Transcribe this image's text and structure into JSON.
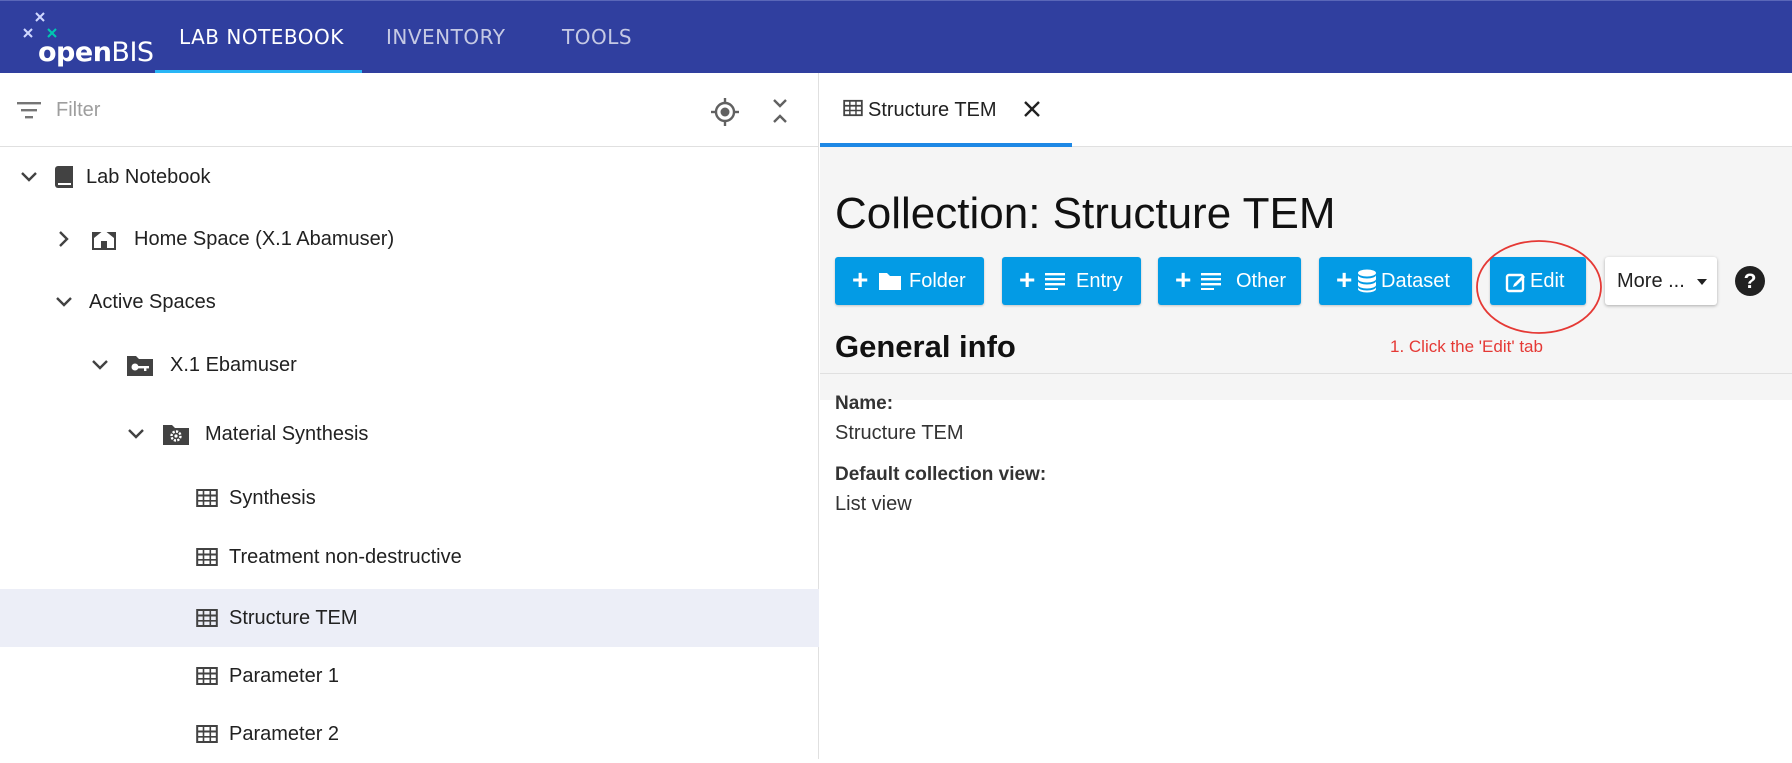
{
  "app": {
    "logo_text_bold": "open",
    "logo_text_rest": "BIS"
  },
  "nav": {
    "tabs": [
      {
        "label": "LAB NOTEBOOK",
        "active": true
      },
      {
        "label": "INVENTORY",
        "active": false
      },
      {
        "label": "TOOLS",
        "active": false
      }
    ]
  },
  "sidebar": {
    "filter_placeholder": "Filter",
    "tree": [
      {
        "label": "Lab Notebook",
        "level": 0,
        "expanded": true,
        "icon": "book-icon"
      },
      {
        "label": "Home Space (X.1 Abamuser)",
        "level": 1,
        "expanded": false,
        "icon": "home-icon"
      },
      {
        "label": "Active Spaces",
        "level": 1,
        "expanded": true,
        "icon": null
      },
      {
        "label": "X.1 Ebamuser",
        "level": 2,
        "expanded": true,
        "icon": "key-folder-icon"
      },
      {
        "label": "Material Synthesis",
        "level": 3,
        "expanded": true,
        "icon": "gear-folder-icon"
      },
      {
        "label": "Synthesis",
        "level": 4,
        "icon": "table-icon"
      },
      {
        "label": "Treatment non-destructive",
        "level": 4,
        "icon": "table-icon"
      },
      {
        "label": "Structure TEM",
        "level": 4,
        "icon": "table-icon",
        "selected": true
      },
      {
        "label": "Parameter 1",
        "level": 4,
        "icon": "table-icon"
      },
      {
        "label": "Parameter 2",
        "level": 4,
        "icon": "table-icon"
      }
    ]
  },
  "main": {
    "tab_label": "Structure TEM",
    "page_title": "Collection: Structure TEM",
    "buttons": {
      "folder": "Folder",
      "entry": "Entry",
      "other": "Other",
      "dataset": "Dataset",
      "edit": "Edit",
      "more": "More ..."
    },
    "annotation": "1. Click the 'Edit' tab",
    "section_title": "General info",
    "fields": [
      {
        "name": "Name:",
        "value": "Structure TEM"
      },
      {
        "name": "Default collection view:",
        "value": "List view"
      }
    ]
  },
  "colors": {
    "topbar": "#303f9f",
    "accent": "#039be5",
    "annotation": "#e53935",
    "selected_row": "#eceef7"
  }
}
